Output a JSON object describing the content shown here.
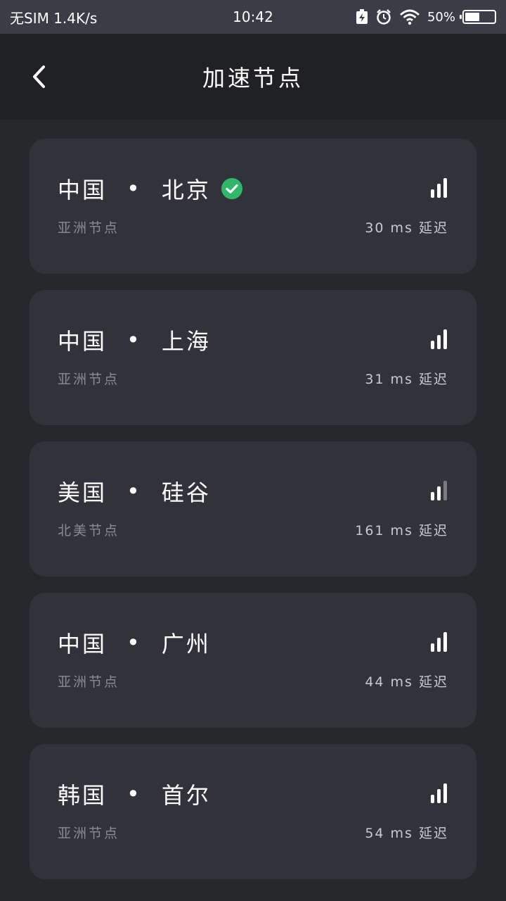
{
  "status_bar": {
    "sim_speed": "无SIM 1.4K/s",
    "time": "10:42",
    "battery_percent": "50%",
    "battery_level": 0.5
  },
  "app_bar": {
    "title": "加速节点"
  },
  "colors": {
    "accent_green": "#2fb86a",
    "card_bg": "#32333a",
    "page_bg": "#26272b"
  },
  "nodes": [
    {
      "country": "中国",
      "separator": "•",
      "city": "北京",
      "region": "亚洲节点",
      "latency": "30 ms 延迟",
      "signal_level": 3,
      "selected": true
    },
    {
      "country": "中国",
      "separator": "•",
      "city": "上海",
      "region": "亚洲节点",
      "latency": "31 ms 延迟",
      "signal_level": 3,
      "selected": false
    },
    {
      "country": "美国",
      "separator": "•",
      "city": "硅谷",
      "region": "北美节点",
      "latency": "161 ms 延迟",
      "signal_level": 2,
      "selected": false
    },
    {
      "country": "中国",
      "separator": "•",
      "city": "广州",
      "region": "亚洲节点",
      "latency": "44 ms 延迟",
      "signal_level": 3,
      "selected": false
    },
    {
      "country": "韩国",
      "separator": "•",
      "city": "首尔",
      "region": "亚洲节点",
      "latency": "54 ms 延迟",
      "signal_level": 3,
      "selected": false
    }
  ]
}
